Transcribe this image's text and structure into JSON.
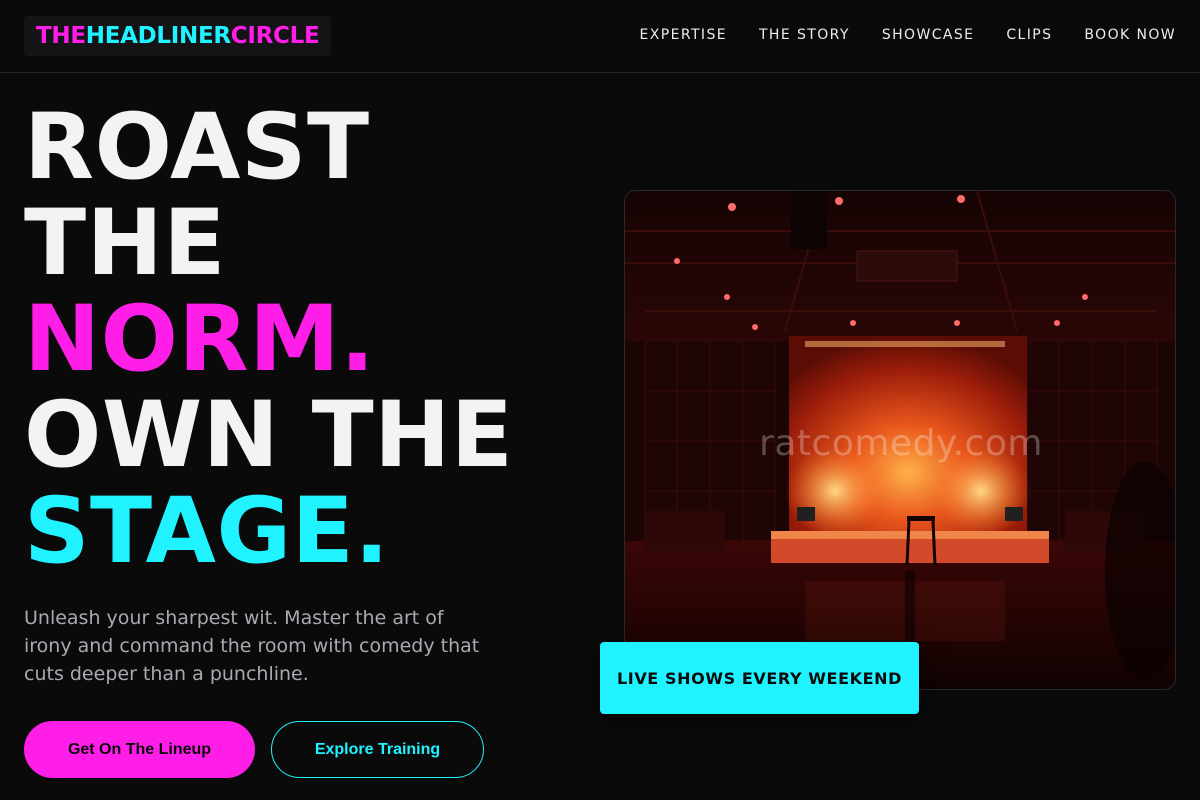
{
  "brand": {
    "part1": "THE ",
    "part2": "HEADLINER",
    "part3": " CIRCLE",
    "colors": {
      "pink": "#ff1ee8",
      "cyan": "#20f2ff",
      "background": "#0a0a0b"
    }
  },
  "nav": {
    "links": [
      "EXPERTISE",
      "THE STORY",
      "SHOWCASE",
      "CLIPS",
      "BOOK NOW"
    ]
  },
  "hero": {
    "lines": [
      "ROAST",
      "THE",
      "NORM.",
      "OWN THE",
      "STAGE."
    ],
    "subtitle": "Unleash your sharpest wit. Master the art of irony and command the room with comedy that cuts deeper than a punchline.",
    "primary_cta": "Get On The Lineup",
    "secondary_cta": "Explore Training"
  },
  "image": {
    "watermark": "ratcomedy.com",
    "badge": "LIVE SHOWS EVERY WEEKEND"
  }
}
